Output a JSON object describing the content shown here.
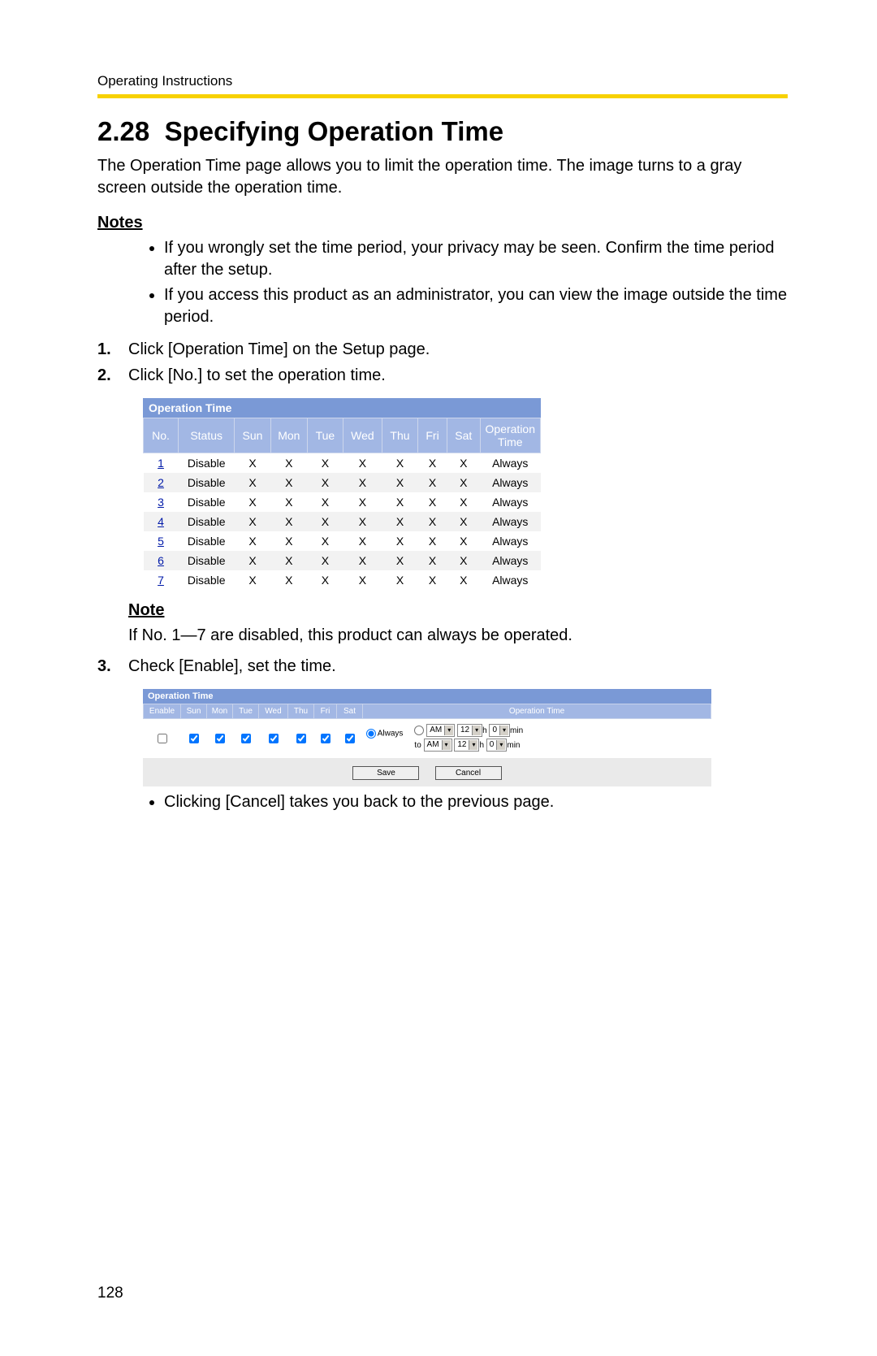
{
  "running_header": "Operating Instructions",
  "section_number": "2.28",
  "section_title": "Specifying Operation Time",
  "intro": "The Operation Time page allows you to limit the operation time. The image turns to a gray screen outside the operation time.",
  "notes_heading": "Notes",
  "notes": [
    "If you wrongly set the time period, your privacy may be seen. Confirm the time period after the setup.",
    "If you access this product as an administrator, you can view the image outside the time period."
  ],
  "steps": [
    "Click [Operation Time] on the Setup page.",
    "Click [No.] to set the operation time.",
    "Check [Enable], set the time."
  ],
  "note_heading": "Note",
  "note_text": "If No. 1—7 are disabled, this product can always be operated.",
  "after_step3_bullet": "Clicking [Cancel] takes you back to the previous page.",
  "page_number": "128",
  "op_panel": {
    "title": "Operation Time",
    "headers": [
      "No.",
      "Status",
      "Sun",
      "Mon",
      "Tue",
      "Wed",
      "Thu",
      "Fri",
      "Sat",
      "Operation Time"
    ],
    "rows": [
      {
        "no": "1",
        "status": "Disable",
        "sun": "X",
        "mon": "X",
        "tue": "X",
        "wed": "X",
        "thu": "X",
        "fri": "X",
        "sat": "X",
        "ot": "Always"
      },
      {
        "no": "2",
        "status": "Disable",
        "sun": "X",
        "mon": "X",
        "tue": "X",
        "wed": "X",
        "thu": "X",
        "fri": "X",
        "sat": "X",
        "ot": "Always"
      },
      {
        "no": "3",
        "status": "Disable",
        "sun": "X",
        "mon": "X",
        "tue": "X",
        "wed": "X",
        "thu": "X",
        "fri": "X",
        "sat": "X",
        "ot": "Always"
      },
      {
        "no": "4",
        "status": "Disable",
        "sun": "X",
        "mon": "X",
        "tue": "X",
        "wed": "X",
        "thu": "X",
        "fri": "X",
        "sat": "X",
        "ot": "Always"
      },
      {
        "no": "5",
        "status": "Disable",
        "sun": "X",
        "mon": "X",
        "tue": "X",
        "wed": "X",
        "thu": "X",
        "fri": "X",
        "sat": "X",
        "ot": "Always"
      },
      {
        "no": "6",
        "status": "Disable",
        "sun": "X",
        "mon": "X",
        "tue": "X",
        "wed": "X",
        "thu": "X",
        "fri": "X",
        "sat": "X",
        "ot": "Always"
      },
      {
        "no": "7",
        "status": "Disable",
        "sun": "X",
        "mon": "X",
        "tue": "X",
        "wed": "X",
        "thu": "X",
        "fri": "X",
        "sat": "X",
        "ot": "Always"
      }
    ]
  },
  "set_panel": {
    "title": "Operation Time",
    "headers": [
      "Enable",
      "Sun",
      "Mon",
      "Tue",
      "Wed",
      "Thu",
      "Fri",
      "Sat",
      "Operation Time"
    ],
    "enable_checked": false,
    "days_checked": [
      true,
      true,
      true,
      true,
      true,
      true,
      true
    ],
    "always_label": "Always",
    "always_selected": true,
    "from": {
      "ampm": "AM",
      "h": "12",
      "m": "0"
    },
    "to": {
      "ampm": "AM",
      "h": "12",
      "m": "0"
    },
    "h_label": "h",
    "min_label": "min",
    "to_label": "to",
    "save_label": "Save",
    "cancel_label": "Cancel"
  }
}
